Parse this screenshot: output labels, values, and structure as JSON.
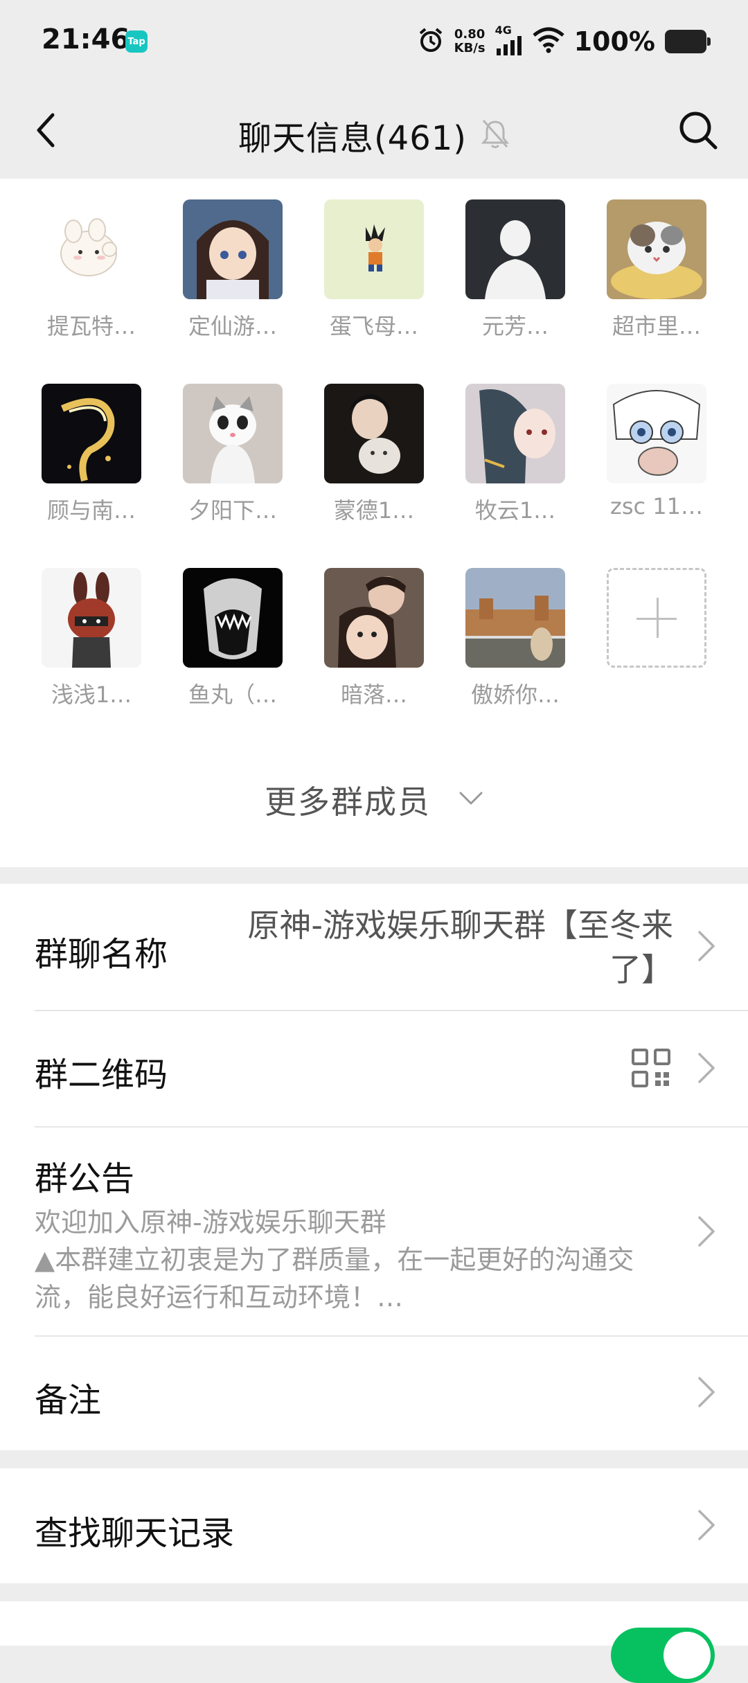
{
  "status_bar": {
    "time": "21:46",
    "tap_badge": "Tap",
    "net_speed_value": "0.80",
    "net_speed_unit": "KB/s",
    "network_type": "4G",
    "battery": "100%",
    "icons": [
      "alarm-icon",
      "signal-icon",
      "wifi-icon",
      "battery-icon"
    ]
  },
  "nav": {
    "title": "聊天信息(461)",
    "icons": [
      "back-icon",
      "mute-bell-icon",
      "search-icon"
    ]
  },
  "members": [
    {
      "name": "提瓦特…"
    },
    {
      "name": "定仙游…"
    },
    {
      "name": "蛋飞母…"
    },
    {
      "name": "元芳…"
    },
    {
      "name": "超市里…"
    },
    {
      "name": "顾与南…"
    },
    {
      "name": "夕阳下…"
    },
    {
      "name": "蒙德1…"
    },
    {
      "name": "牧云1…"
    },
    {
      "name": "zsc 11…"
    },
    {
      "name": "浅浅1…"
    },
    {
      "name": "鱼丸（…"
    },
    {
      "name": "暗落…"
    },
    {
      "name": "傲娇你…"
    }
  ],
  "more_members": "更多群成员",
  "group_name": {
    "label": "群聊名称",
    "value": "原神-游戏娱乐聊天群【至冬来了】"
  },
  "qr_code": {
    "label": "群二维码"
  },
  "notice": {
    "label": "群公告",
    "text": "欢迎加入原神-游戏娱乐聊天群\n▲本群建立初衷是为了群质量，在一起更好的沟通交流，能良好运行和互动环境！…"
  },
  "remark": {
    "label": "备注"
  },
  "search_history": {
    "label": "查找聊天记录"
  },
  "colors": {
    "background": "#ededed",
    "accent_green": "#07c160",
    "secondary_text": "#9b9b9b"
  }
}
